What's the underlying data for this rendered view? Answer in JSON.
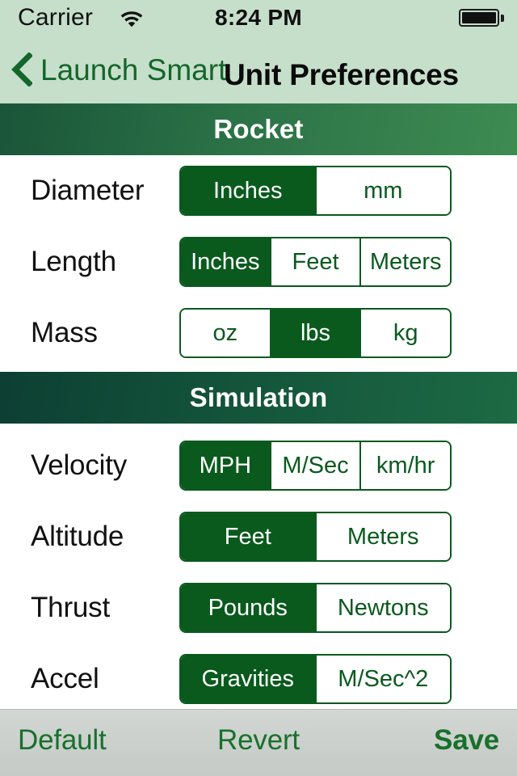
{
  "status_bar": {
    "carrier": "Carrier",
    "wifi_icon": "wifi-icon",
    "time": "8:24 PM",
    "battery_icon": "battery-full-icon"
  },
  "nav_bar": {
    "back_icon": "chevron-left-icon",
    "back_label": "Launch Smart",
    "title": "Unit Preferences"
  },
  "sections": [
    {
      "header": "Rocket",
      "rows": [
        {
          "label": "Diameter",
          "options": [
            "Inches",
            "mm"
          ],
          "selected": 0
        },
        {
          "label": "Length",
          "options": [
            "Inches",
            "Feet",
            "Meters"
          ],
          "selected": 0
        },
        {
          "label": "Mass",
          "options": [
            "oz",
            "lbs",
            "kg"
          ],
          "selected": 1
        }
      ]
    },
    {
      "header": "Simulation",
      "rows": [
        {
          "label": "Velocity",
          "options": [
            "MPH",
            "M/Sec",
            "km/hr"
          ],
          "selected": 0
        },
        {
          "label": "Altitude",
          "options": [
            "Feet",
            "Meters"
          ],
          "selected": 0
        },
        {
          "label": "Thrust",
          "options": [
            "Pounds",
            "Newtons"
          ],
          "selected": 0
        },
        {
          "label": "Accel",
          "options": [
            "Gravities",
            "M/Sec^2"
          ],
          "selected": 0
        }
      ]
    }
  ],
  "toolbar": {
    "default_label": "Default",
    "revert_label": "Revert",
    "save_label": "Save"
  },
  "colors": {
    "accent_green": "#0a5a1e",
    "nav_background": "#c6dfcb",
    "link_green": "#14662b",
    "toolbar_background": "#cdd2ce",
    "rocket_header_from": "#1a5539",
    "rocket_header_to": "#3e8b52",
    "simulation_header_from": "#0d3f33",
    "simulation_header_to": "#1d6a44"
  }
}
